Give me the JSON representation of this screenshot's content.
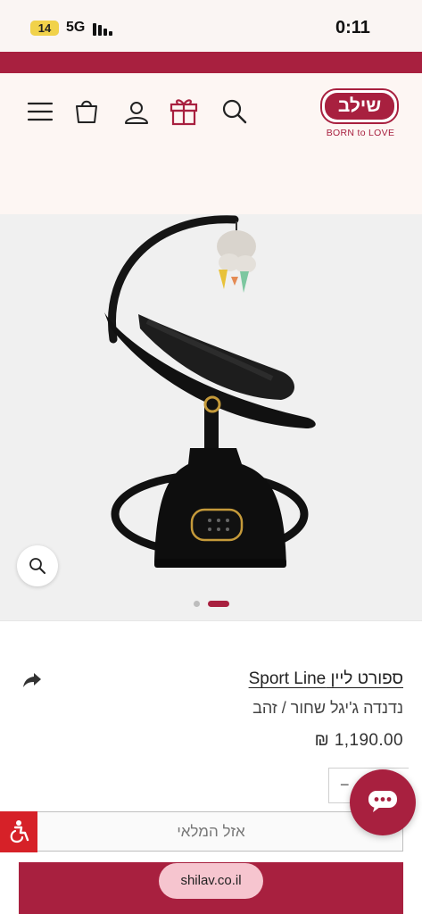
{
  "status_bar": {
    "battery": "14",
    "network": "5G",
    "time": "0:11"
  },
  "header": {
    "logo_text": "שילב",
    "logo_tagline": "BORN to LOVE",
    "brand_color": "#a8203f"
  },
  "gallery": {
    "slide_count": 2,
    "active_slide": 2
  },
  "product": {
    "title": "ספורט ליין Sport Line",
    "subtitle": "נדנדה ג'יגל שחור / זהב",
    "price": "1,190.00 ₪"
  },
  "quantity": {
    "minus_label": "−"
  },
  "actions": {
    "sold_out_label": "אזל המלאי"
  },
  "browser": {
    "url": "shilav.co.il"
  },
  "icons": [
    "menu-icon",
    "shopping-bag-icon",
    "user-icon",
    "gift-icon",
    "search-icon",
    "zoom-icon",
    "share-icon",
    "chat-icon",
    "accessibility-icon"
  ]
}
